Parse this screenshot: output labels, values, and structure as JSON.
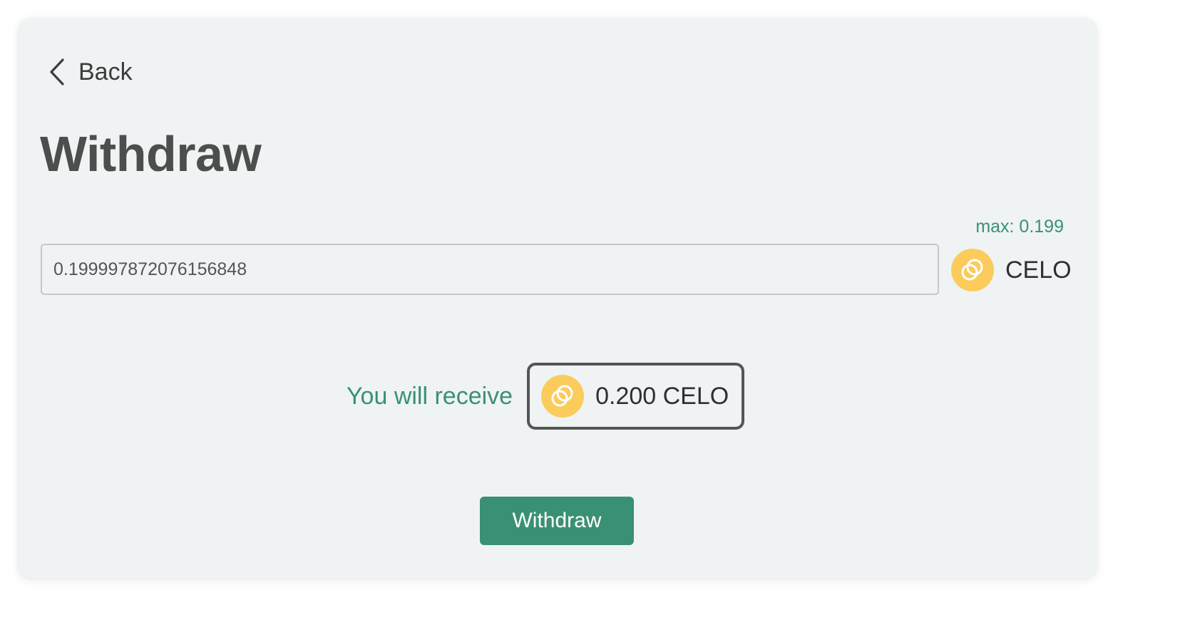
{
  "back_label": "Back",
  "page_title": "Withdraw",
  "amount": {
    "max_label": "max: 0.199",
    "value": "0.199997872076156848",
    "token_symbol": "CELO",
    "token_icon": "celo-coin-icon"
  },
  "receive": {
    "label": "You will receive",
    "amount": "0.200 CELO",
    "token_icon": "celo-coin-icon"
  },
  "withdraw_button_label": "Withdraw",
  "colors": {
    "accent_green": "#3a9074",
    "coin_yellow": "#fbcc5c",
    "card_background": "#eff3f4",
    "title_gray": "#4d4d4d"
  }
}
